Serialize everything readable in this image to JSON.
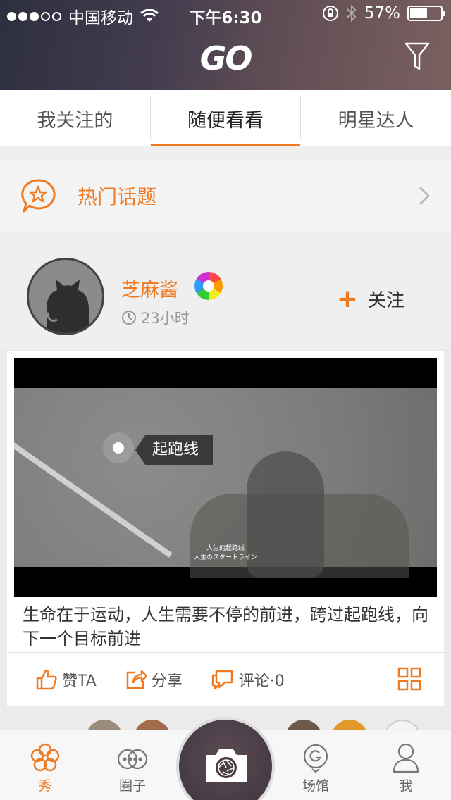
{
  "status_bar": {
    "carrier": "中国移动",
    "time": "下午6:30",
    "battery": "57%"
  },
  "header": {
    "logo": "GO"
  },
  "tabs": [
    {
      "label": "我关注的"
    },
    {
      "label": "随便看看"
    },
    {
      "label": "明星达人"
    }
  ],
  "hot_topics": {
    "label": "热门话题"
  },
  "post": {
    "username": "芝麻酱",
    "time_ago": "23小时",
    "follow_label": "关注",
    "video": {
      "tag": "起跑线",
      "subtitle_line1": "人生的起跑线",
      "subtitle_line2": "人生のスタートライン"
    },
    "caption": "生命在于运动，人生需要不停的前进，跨过起跑线，向下一个目标前进",
    "actions": {
      "like": "赞TA",
      "share": "分享",
      "comment": "评论·0"
    }
  },
  "tabbar": {
    "items": [
      {
        "label": "秀"
      },
      {
        "label": "圈子"
      },
      {
        "label": "场馆"
      },
      {
        "label": "我"
      }
    ]
  },
  "colors": {
    "accent": "#f07a22"
  }
}
